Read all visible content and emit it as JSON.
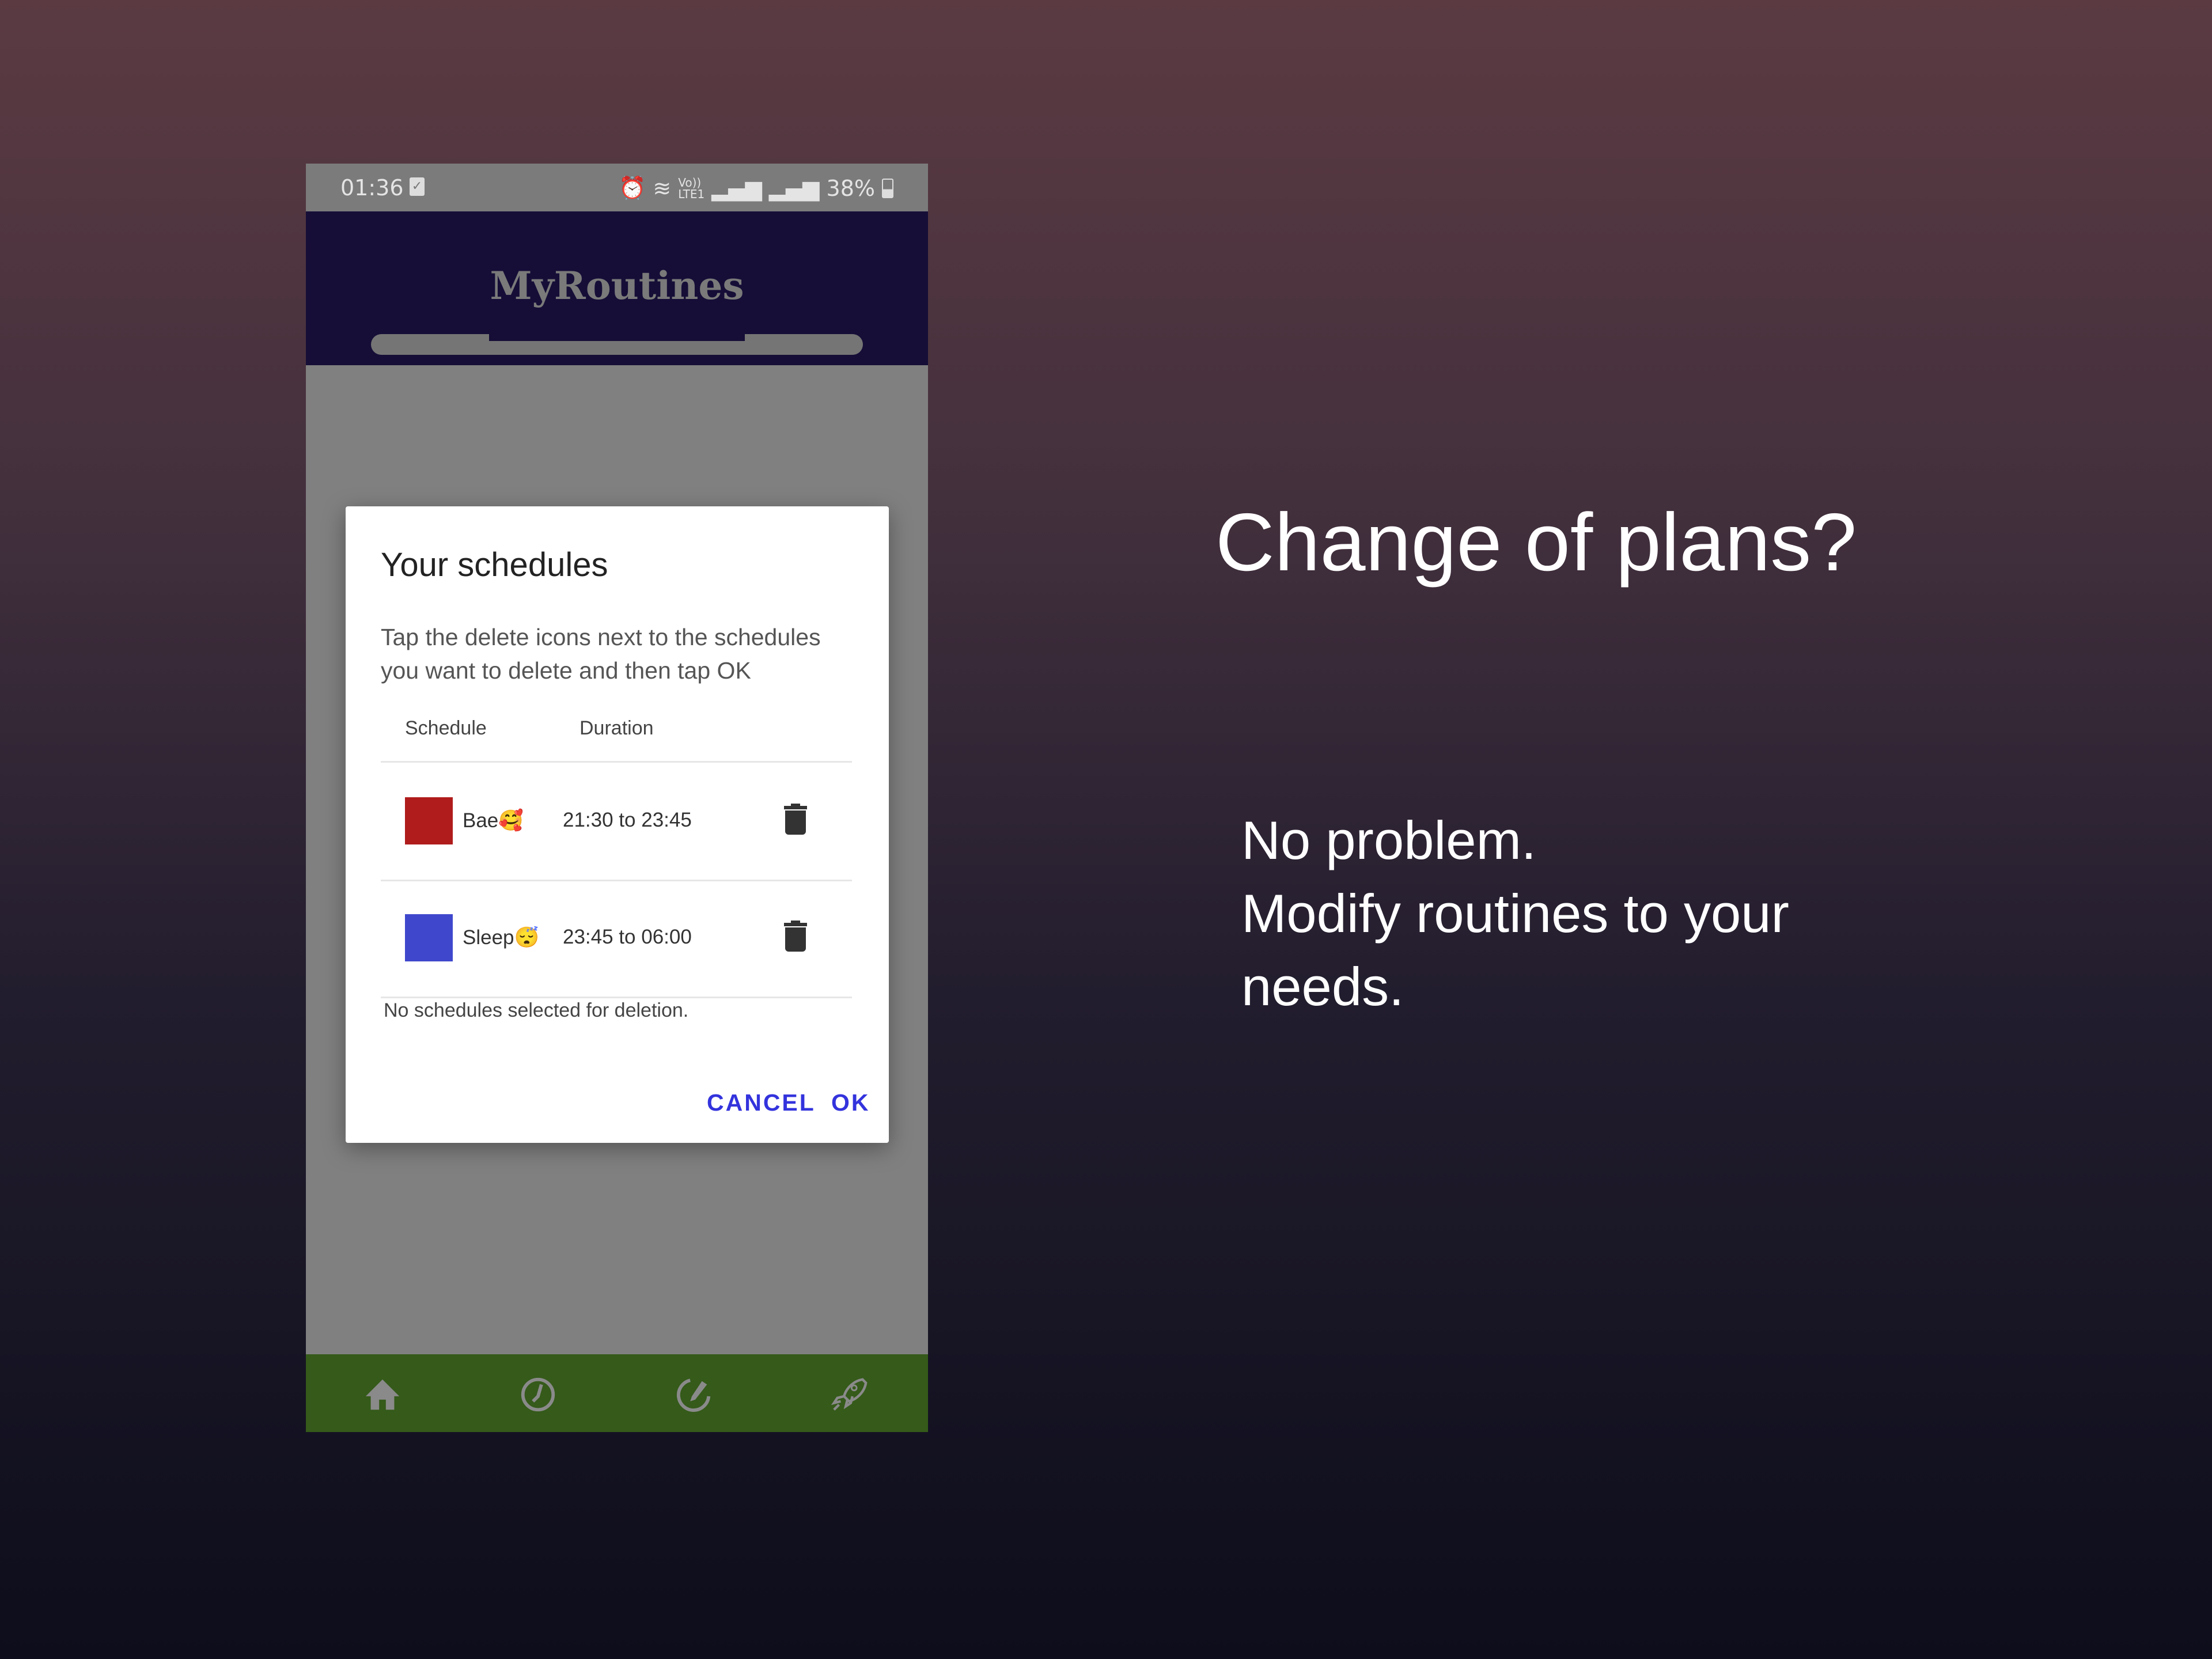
{
  "status_bar": {
    "time": "01:36",
    "network": "LTE1",
    "volte": "Vo))",
    "battery": "38%",
    "battery_level": 0.38
  },
  "app": {
    "title": "MyRoutines"
  },
  "dialog": {
    "title": "Your schedules",
    "description": "Tap the delete icons next to the schedules you want to delete and then tap OK",
    "columns": [
      "Schedule",
      "Duration"
    ],
    "rows": [
      {
        "name": "Bae🥰",
        "duration": "21:30 to 23:45",
        "color": "#b01c1c"
      },
      {
        "name": "Sleep😴",
        "duration": "23:45 to 06:00",
        "color": "#3f48cc"
      }
    ],
    "status": "No schedules selected for deletion.",
    "cancel": "CANCEL",
    "ok": "OK"
  },
  "nav": [
    "home-icon",
    "clock-icon",
    "edit-icon",
    "rocket-icon"
  ],
  "promo": {
    "headline": "Change of plans?",
    "line1": "No problem.",
    "line2": "Modify routines to your",
    "line3": "needs."
  }
}
